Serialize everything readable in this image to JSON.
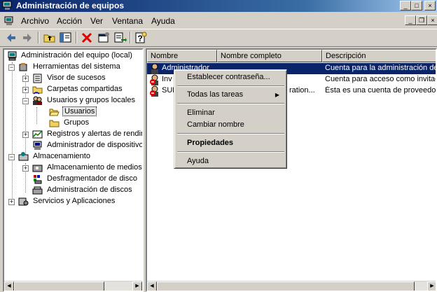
{
  "window": {
    "title": "Administración de equipos",
    "controls": {
      "minimize": "_",
      "maximize": "□",
      "close": "×"
    }
  },
  "menubar": {
    "items": [
      "Archivo",
      "Acción",
      "Ver",
      "Ventana",
      "Ayuda"
    ],
    "mdi_controls": {
      "minimize": "_",
      "restore": "❐",
      "close": "×"
    }
  },
  "toolbar": {
    "buttons": [
      "back-icon",
      "forward-icon",
      "up-folder-icon",
      "show-hide-tree-icon",
      "delete-icon",
      "properties-icon",
      "export-list-icon",
      "help-icon"
    ]
  },
  "tree": {
    "root": "Administración del equipo (local)",
    "items": [
      "Herramientas del sistema",
      "Visor de sucesos",
      "Carpetas compartidas",
      "Usuarios y grupos locales",
      "Usuarios",
      "Grupos",
      "Registros y alertas de rendir",
      "Administrador de dispositivo",
      "Almacenamiento",
      "Almacenamiento de medios e",
      "Desfragmentador de disco",
      "Administración de discos",
      "Servicios y Aplicaciones"
    ],
    "selected": "Usuarios"
  },
  "list": {
    "columns": [
      "Nombre",
      "Nombre completo",
      "Descripción"
    ],
    "rows": [
      {
        "name": "Administrador",
        "full_name": "",
        "description": "Cuenta para la administración del"
      },
      {
        "name": "Inv",
        "full_name": "",
        "description": "Cuenta para acceso como invitad"
      },
      {
        "name": "SUF",
        "full_name": "ration...",
        "description": "Ésta es una cuenta de proveedor"
      }
    ],
    "selected_row": 0
  },
  "context_menu": {
    "items": [
      "Establecer contraseña...",
      "Todas las tareas",
      "Eliminar",
      "Cambiar nombre",
      "Propiedades",
      "Ayuda"
    ],
    "submenu_arrow": "▶"
  },
  "scrollbars": {
    "left_arrow": "◀",
    "right_arrow": "▶"
  },
  "colors": {
    "title_start": "#0a246a",
    "title_end": "#a6caf0",
    "selection": "#0a246a",
    "face": "#d4d0c8"
  }
}
